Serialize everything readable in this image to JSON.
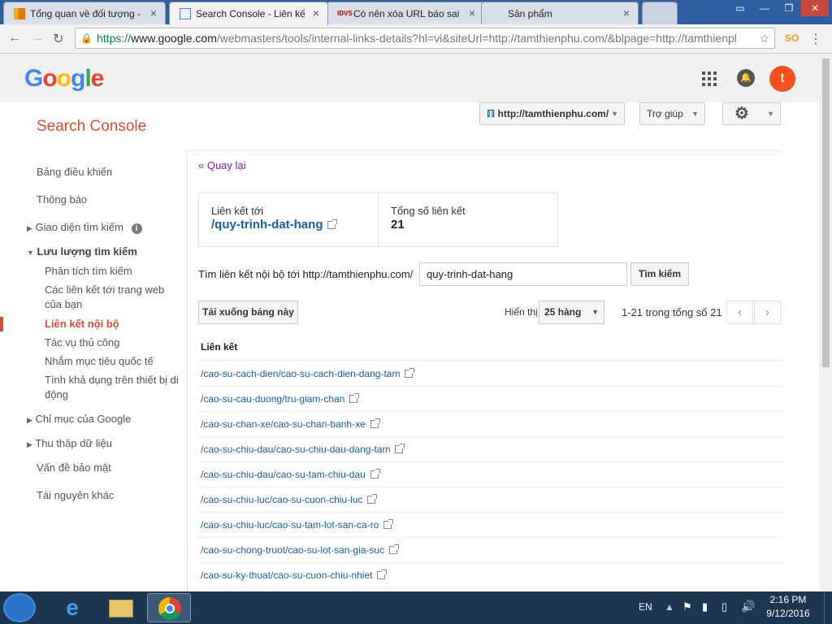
{
  "browser": {
    "tabs": [
      {
        "title": "Tổng quan về đối tượng - ",
        "favicon": "analytics-icon"
      },
      {
        "title": "Search Console - Liên kết",
        "favicon": "search-console-icon",
        "active": true
      },
      {
        "title": "Có nên xóa URL báo sai t",
        "favicon": "idvs-icon"
      },
      {
        "title": "Sản phẩm",
        "favicon": ""
      }
    ],
    "url_secure": "https://",
    "url_domain": "www.google.com",
    "url_path": "/webmasters/tools/internal-links-details?hl=vi&siteUrl=http://tamthienphu.com/&blpage=http://tamthienpl"
  },
  "header": {
    "logo": "Google",
    "avatar_letter": "t"
  },
  "sc": {
    "title": "Search Console",
    "site_selector": "http://tamthienphu.com/",
    "help_label": "Trợ giúp"
  },
  "sidebar": {
    "items": [
      {
        "label": "Bảng điều khiển"
      },
      {
        "label": "Thông báo"
      },
      {
        "label": "Giao diện tìm kiếm"
      },
      {
        "label": "Lưu lượng tìm kiếm"
      },
      {
        "label": "Phân tích tìm kiếm"
      },
      {
        "label": "Các liên kết tới trang web"
      },
      {
        "label": "của bạn"
      },
      {
        "label": "Liên kết nội bộ"
      },
      {
        "label": "Tác vụ thủ công"
      },
      {
        "label": "Nhắm mục tiêu quốc tế"
      },
      {
        "label": "Tính khả dụng trên thiết bị di"
      },
      {
        "label": "động"
      },
      {
        "label": "Chỉ mục của Google"
      },
      {
        "label": "Thu thập dữ liệu"
      },
      {
        "label": "Vấn đề bảo mật"
      },
      {
        "label": "Tài nguyên khác"
      }
    ]
  },
  "main": {
    "back_link": "« Quay lại",
    "links_to_label": "Liên kết tới",
    "links_to_value": "/quy-trinh-dat-hang",
    "total_label": "Tổng số liên kết",
    "total_value": "21",
    "search_label": "Tìm liên kết nội bộ tới http://tamthienphu.com/",
    "search_value": "quy-trinh-dat-hang",
    "search_button": "Tìm kiếm",
    "download_button": "Tải xuống bảng này",
    "show_label": "Hiển thị",
    "rows_value": "25 hàng",
    "range_text": "1-21 trong tổng số 21",
    "column_header": "Liên kết",
    "links": [
      "/cao-su-cach-dien/cao-su-cach-dien-dang-tam",
      "/cao-su-cau-duong/tru-giam-chan",
      "/cao-su-chan-xe/cao-su-chan-banh-xe",
      "/cao-su-chiu-dau/cao-su-chiu-dau-dang-tam",
      "/cao-su-chiu-dau/cao-su-tam-chiu-dau",
      "/cao-su-chiu-luc/cao-su-cuon-chiu-luc",
      "/cao-su-chiu-luc/cao-su-tam-lot-san-ca-ro",
      "/cao-su-chong-truot/cao-su-lot-san-gia-suc",
      "/cao-su-ky-thuat/cao-su-cuon-chiu-nhiet"
    ]
  },
  "taskbar": {
    "lang": "EN",
    "time": "2:16 PM",
    "date": "9/12/2016"
  }
}
